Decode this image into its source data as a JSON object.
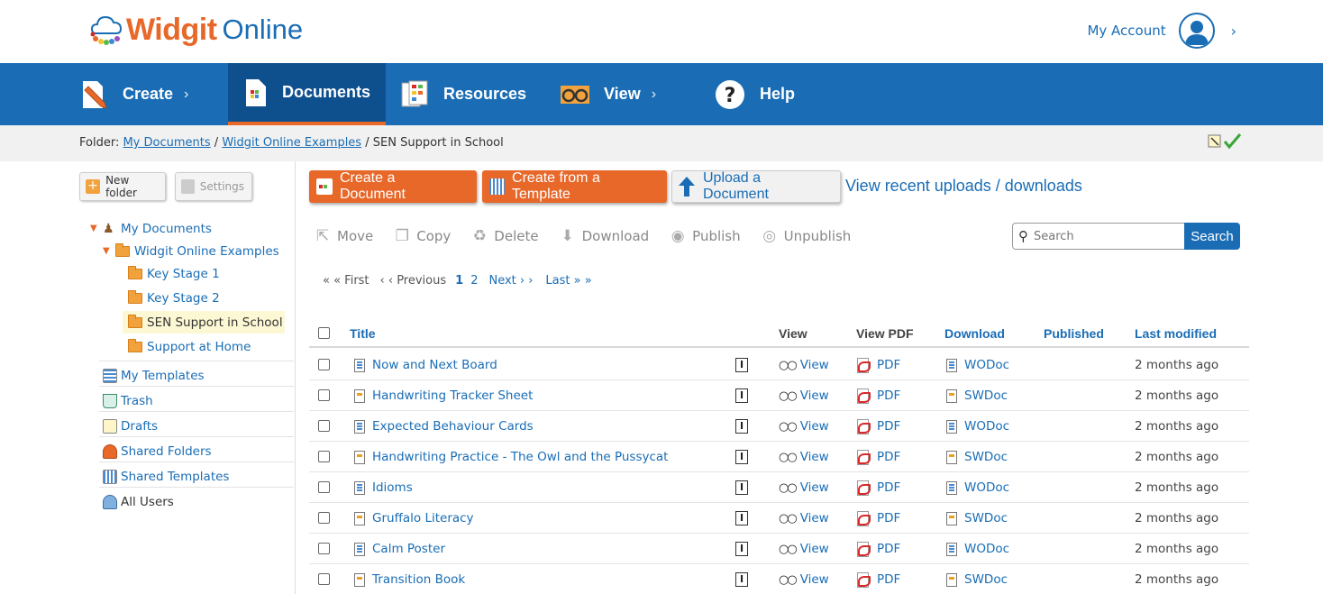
{
  "header": {
    "logo_main": "Widgit",
    "logo_sub": "Online",
    "account_label": "My Account"
  },
  "nav": {
    "items": [
      {
        "label": "Create",
        "icon": "pencil-document-icon",
        "has_chevron": true
      },
      {
        "label": "Documents",
        "icon": "document-icon",
        "active": true
      },
      {
        "label": "Resources",
        "icon": "resources-icon"
      },
      {
        "label": "View",
        "icon": "glasses-icon",
        "has_chevron": true
      },
      {
        "label": "Help",
        "icon": "help-icon"
      }
    ]
  },
  "breadcrumb": {
    "prefix": "Folder:",
    "items": [
      "My Documents",
      "Widgit Online Examples",
      "SEN Support in School"
    ],
    "separator": "/"
  },
  "sidebar": {
    "new_folder": "New folder",
    "settings": "Settings",
    "tree": [
      "My Documents",
      "Widgit Online Examples",
      "Key Stage 1",
      "Key Stage 2",
      "SEN Support in School",
      "Support at Home"
    ],
    "sections": [
      "My Templates",
      "Trash",
      "Drafts",
      "Shared Folders",
      "Shared Templates",
      "All Users"
    ]
  },
  "toolbar": {
    "create_document": "Create a Document",
    "create_template": "Create from a Template",
    "upload": "Upload a Document",
    "recent": "View recent uploads / downloads",
    "actions": [
      "Move",
      "Copy",
      "Delete",
      "Download",
      "Publish",
      "Unpublish"
    ],
    "search_placeholder": "Search",
    "search_button": "Search"
  },
  "pager": {
    "first": "« « First",
    "previous": "‹ ‹ Previous",
    "pages": [
      "1",
      "2"
    ],
    "current": "1",
    "next": "Next › ›",
    "last": "Last » »"
  },
  "table": {
    "headers": {
      "title": "Title",
      "view": "View",
      "view_pdf": "View PDF",
      "download": "Download",
      "published": "Published",
      "last_modified": "Last modified"
    },
    "rows": [
      {
        "title": "Now and Next Board",
        "type": "wo",
        "view": "View",
        "pdf": "PDF",
        "download": "WODoc",
        "modified": "2 months ago"
      },
      {
        "title": "Handwriting Tracker Sheet",
        "type": "sw",
        "view": "View",
        "pdf": "PDF",
        "download": "SWDoc",
        "modified": "2 months ago"
      },
      {
        "title": "Expected Behaviour Cards",
        "type": "wo",
        "view": "View",
        "pdf": "PDF",
        "download": "WODoc",
        "modified": "2 months ago"
      },
      {
        "title": "Handwriting Practice - The Owl and the Pussycat",
        "type": "sw",
        "view": "View",
        "pdf": "PDF",
        "download": "SWDoc",
        "modified": "2 months ago"
      },
      {
        "title": "Idioms",
        "type": "wo",
        "view": "View",
        "pdf": "PDF",
        "download": "WODoc",
        "modified": "2 months ago"
      },
      {
        "title": "Gruffalo Literacy",
        "type": "sw",
        "view": "View",
        "pdf": "PDF",
        "download": "SWDoc",
        "modified": "2 months ago"
      },
      {
        "title": "Calm Poster",
        "type": "wo",
        "view": "View",
        "pdf": "PDF",
        "download": "WODoc",
        "modified": "2 months ago"
      },
      {
        "title": "Transition Book",
        "type": "sw",
        "view": "View",
        "pdf": "PDF",
        "download": "SWDoc",
        "modified": "2 months ago"
      }
    ]
  },
  "colors": {
    "brand_blue": "#1a6db5",
    "nav_active": "#0e4f8e",
    "accent_orange": "#e8682a"
  }
}
